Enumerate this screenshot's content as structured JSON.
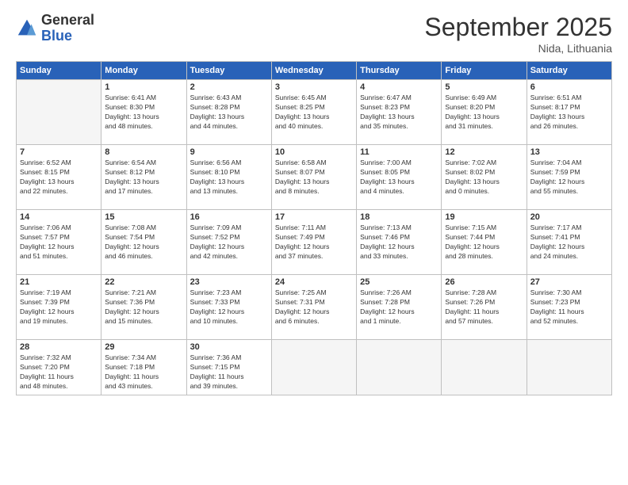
{
  "logo": {
    "general": "General",
    "blue": "Blue"
  },
  "title": "September 2025",
  "location": "Nida, Lithuania",
  "days_of_week": [
    "Sunday",
    "Monday",
    "Tuesday",
    "Wednesday",
    "Thursday",
    "Friday",
    "Saturday"
  ],
  "weeks": [
    [
      {
        "day": "",
        "info": ""
      },
      {
        "day": "1",
        "info": "Sunrise: 6:41 AM\nSunset: 8:30 PM\nDaylight: 13 hours\nand 48 minutes."
      },
      {
        "day": "2",
        "info": "Sunrise: 6:43 AM\nSunset: 8:28 PM\nDaylight: 13 hours\nand 44 minutes."
      },
      {
        "day": "3",
        "info": "Sunrise: 6:45 AM\nSunset: 8:25 PM\nDaylight: 13 hours\nand 40 minutes."
      },
      {
        "day": "4",
        "info": "Sunrise: 6:47 AM\nSunset: 8:23 PM\nDaylight: 13 hours\nand 35 minutes."
      },
      {
        "day": "5",
        "info": "Sunrise: 6:49 AM\nSunset: 8:20 PM\nDaylight: 13 hours\nand 31 minutes."
      },
      {
        "day": "6",
        "info": "Sunrise: 6:51 AM\nSunset: 8:17 PM\nDaylight: 13 hours\nand 26 minutes."
      }
    ],
    [
      {
        "day": "7",
        "info": "Sunrise: 6:52 AM\nSunset: 8:15 PM\nDaylight: 13 hours\nand 22 minutes."
      },
      {
        "day": "8",
        "info": "Sunrise: 6:54 AM\nSunset: 8:12 PM\nDaylight: 13 hours\nand 17 minutes."
      },
      {
        "day": "9",
        "info": "Sunrise: 6:56 AM\nSunset: 8:10 PM\nDaylight: 13 hours\nand 13 minutes."
      },
      {
        "day": "10",
        "info": "Sunrise: 6:58 AM\nSunset: 8:07 PM\nDaylight: 13 hours\nand 8 minutes."
      },
      {
        "day": "11",
        "info": "Sunrise: 7:00 AM\nSunset: 8:05 PM\nDaylight: 13 hours\nand 4 minutes."
      },
      {
        "day": "12",
        "info": "Sunrise: 7:02 AM\nSunset: 8:02 PM\nDaylight: 13 hours\nand 0 minutes."
      },
      {
        "day": "13",
        "info": "Sunrise: 7:04 AM\nSunset: 7:59 PM\nDaylight: 12 hours\nand 55 minutes."
      }
    ],
    [
      {
        "day": "14",
        "info": "Sunrise: 7:06 AM\nSunset: 7:57 PM\nDaylight: 12 hours\nand 51 minutes."
      },
      {
        "day": "15",
        "info": "Sunrise: 7:08 AM\nSunset: 7:54 PM\nDaylight: 12 hours\nand 46 minutes."
      },
      {
        "day": "16",
        "info": "Sunrise: 7:09 AM\nSunset: 7:52 PM\nDaylight: 12 hours\nand 42 minutes."
      },
      {
        "day": "17",
        "info": "Sunrise: 7:11 AM\nSunset: 7:49 PM\nDaylight: 12 hours\nand 37 minutes."
      },
      {
        "day": "18",
        "info": "Sunrise: 7:13 AM\nSunset: 7:46 PM\nDaylight: 12 hours\nand 33 minutes."
      },
      {
        "day": "19",
        "info": "Sunrise: 7:15 AM\nSunset: 7:44 PM\nDaylight: 12 hours\nand 28 minutes."
      },
      {
        "day": "20",
        "info": "Sunrise: 7:17 AM\nSunset: 7:41 PM\nDaylight: 12 hours\nand 24 minutes."
      }
    ],
    [
      {
        "day": "21",
        "info": "Sunrise: 7:19 AM\nSunset: 7:39 PM\nDaylight: 12 hours\nand 19 minutes."
      },
      {
        "day": "22",
        "info": "Sunrise: 7:21 AM\nSunset: 7:36 PM\nDaylight: 12 hours\nand 15 minutes."
      },
      {
        "day": "23",
        "info": "Sunrise: 7:23 AM\nSunset: 7:33 PM\nDaylight: 12 hours\nand 10 minutes."
      },
      {
        "day": "24",
        "info": "Sunrise: 7:25 AM\nSunset: 7:31 PM\nDaylight: 12 hours\nand 6 minutes."
      },
      {
        "day": "25",
        "info": "Sunrise: 7:26 AM\nSunset: 7:28 PM\nDaylight: 12 hours\nand 1 minute."
      },
      {
        "day": "26",
        "info": "Sunrise: 7:28 AM\nSunset: 7:26 PM\nDaylight: 11 hours\nand 57 minutes."
      },
      {
        "day": "27",
        "info": "Sunrise: 7:30 AM\nSunset: 7:23 PM\nDaylight: 11 hours\nand 52 minutes."
      }
    ],
    [
      {
        "day": "28",
        "info": "Sunrise: 7:32 AM\nSunset: 7:20 PM\nDaylight: 11 hours\nand 48 minutes."
      },
      {
        "day": "29",
        "info": "Sunrise: 7:34 AM\nSunset: 7:18 PM\nDaylight: 11 hours\nand 43 minutes."
      },
      {
        "day": "30",
        "info": "Sunrise: 7:36 AM\nSunset: 7:15 PM\nDaylight: 11 hours\nand 39 minutes."
      },
      {
        "day": "",
        "info": ""
      },
      {
        "day": "",
        "info": ""
      },
      {
        "day": "",
        "info": ""
      },
      {
        "day": "",
        "info": ""
      }
    ]
  ]
}
